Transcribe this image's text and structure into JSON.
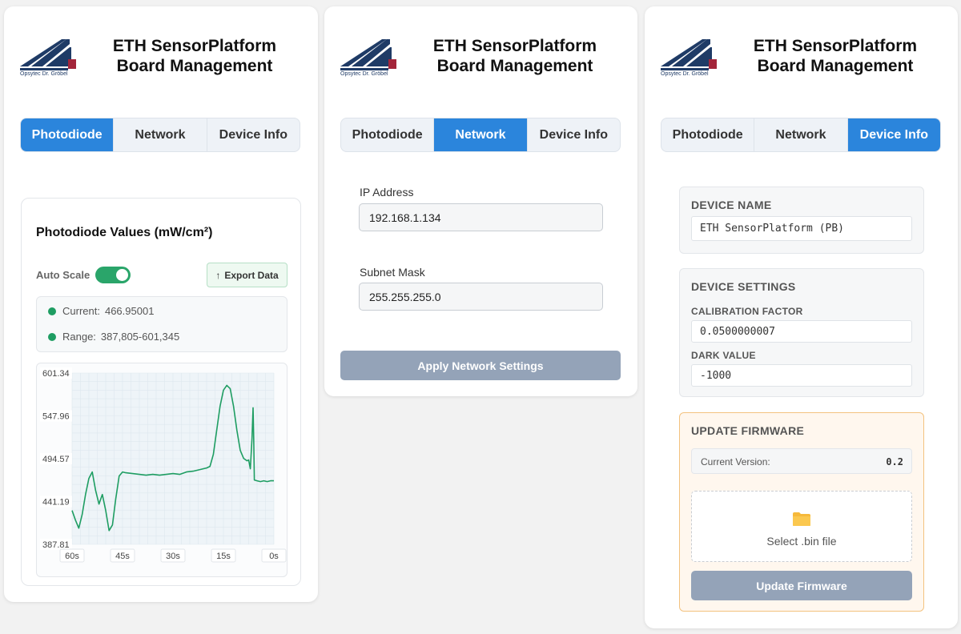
{
  "brand": {
    "logo_text": "Opsytec Dr. Gröbel",
    "title_line1": "ETH SensorPlatform",
    "title_line2": "Board Management",
    "colors": {
      "navy": "#1f3b66",
      "red": "#a3253a"
    }
  },
  "tabs": [
    "Photodiode",
    "Network",
    "Device Info"
  ],
  "colors": {
    "accent": "#2b85dc",
    "green": "#1e9d62",
    "disabled": "#94a3b8",
    "warning_border": "#f3c27f"
  },
  "photodiode": {
    "panel_title": "Photodiode Values (mW/cm²)",
    "autoscale_label": "Auto Scale",
    "autoscale_on": true,
    "export_label": "Export Data",
    "export_icon": "upload-arrow-icon",
    "current_label": "Current:",
    "current_value": "466.95001",
    "range_label": "Range:",
    "range_value": "387,805-601,345"
  },
  "chart_data": {
    "type": "line",
    "title": "",
    "xlabel": "",
    "ylabel": "",
    "ylim": [
      387.81,
      601.34
    ],
    "xlim": [
      -60,
      0
    ],
    "ytick_labels": [
      "601.34",
      "547.96",
      "494.57",
      "441.19",
      "387.81"
    ],
    "xtick_labels": [
      "60s",
      "45s",
      "30s",
      "15s",
      "0s"
    ],
    "grid": true,
    "series": [
      {
        "color": "#1e9d62",
        "points": [
          [
            -60,
            430
          ],
          [
            -59,
            418
          ],
          [
            -58,
            408
          ],
          [
            -57,
            425
          ],
          [
            -56,
            450
          ],
          [
            -55,
            470
          ],
          [
            -54,
            478
          ],
          [
            -53,
            455
          ],
          [
            -52,
            438
          ],
          [
            -51,
            450
          ],
          [
            -50,
            430
          ],
          [
            -49,
            405
          ],
          [
            -48,
            412
          ],
          [
            -47,
            445
          ],
          [
            -46,
            473
          ],
          [
            -45,
            478
          ],
          [
            -44,
            477
          ],
          [
            -42,
            476
          ],
          [
            -40,
            475
          ],
          [
            -38,
            474
          ],
          [
            -36,
            475
          ],
          [
            -34,
            474
          ],
          [
            -32,
            475
          ],
          [
            -30,
            476
          ],
          [
            -28,
            475
          ],
          [
            -26,
            478
          ],
          [
            -24,
            479
          ],
          [
            -22,
            481
          ],
          [
            -20,
            483
          ],
          [
            -19,
            485
          ],
          [
            -18,
            500
          ],
          [
            -17,
            530
          ],
          [
            -16,
            560
          ],
          [
            -15,
            580
          ],
          [
            -14,
            586
          ],
          [
            -13,
            582
          ],
          [
            -12,
            560
          ],
          [
            -11,
            530
          ],
          [
            -10,
            505
          ],
          [
            -9,
            495
          ],
          [
            -8,
            492
          ],
          [
            -7.5,
            493
          ],
          [
            -7,
            482
          ],
          [
            -6.5,
            520
          ],
          [
            -6.2,
            558
          ],
          [
            -6,
            520
          ],
          [
            -5.8,
            468
          ],
          [
            -5,
            467
          ],
          [
            -4,
            466
          ],
          [
            -3,
            467
          ],
          [
            -2,
            466
          ],
          [
            -1,
            467
          ],
          [
            0,
            467
          ]
        ]
      }
    ]
  },
  "network": {
    "ip_label": "IP Address",
    "ip_value": "192.168.1.134",
    "subnet_label": "Subnet Mask",
    "subnet_value": "255.255.255.0",
    "apply_label": "Apply Network Settings"
  },
  "device": {
    "name_section": "DEVICE NAME",
    "name_value": "ETH SensorPlatform (PB)",
    "settings_section": "DEVICE SETTINGS",
    "calibration_label": "CALIBRATION FACTOR",
    "calibration_value": "0.0500000007",
    "dark_label": "DARK VALUE",
    "dark_value": "-1000",
    "firmware_section": "UPDATE FIRMWARE",
    "version_label": "Current Version:",
    "version_value": "0.2",
    "select_file_label": "Select .bin file",
    "update_label": "Update Firmware"
  }
}
